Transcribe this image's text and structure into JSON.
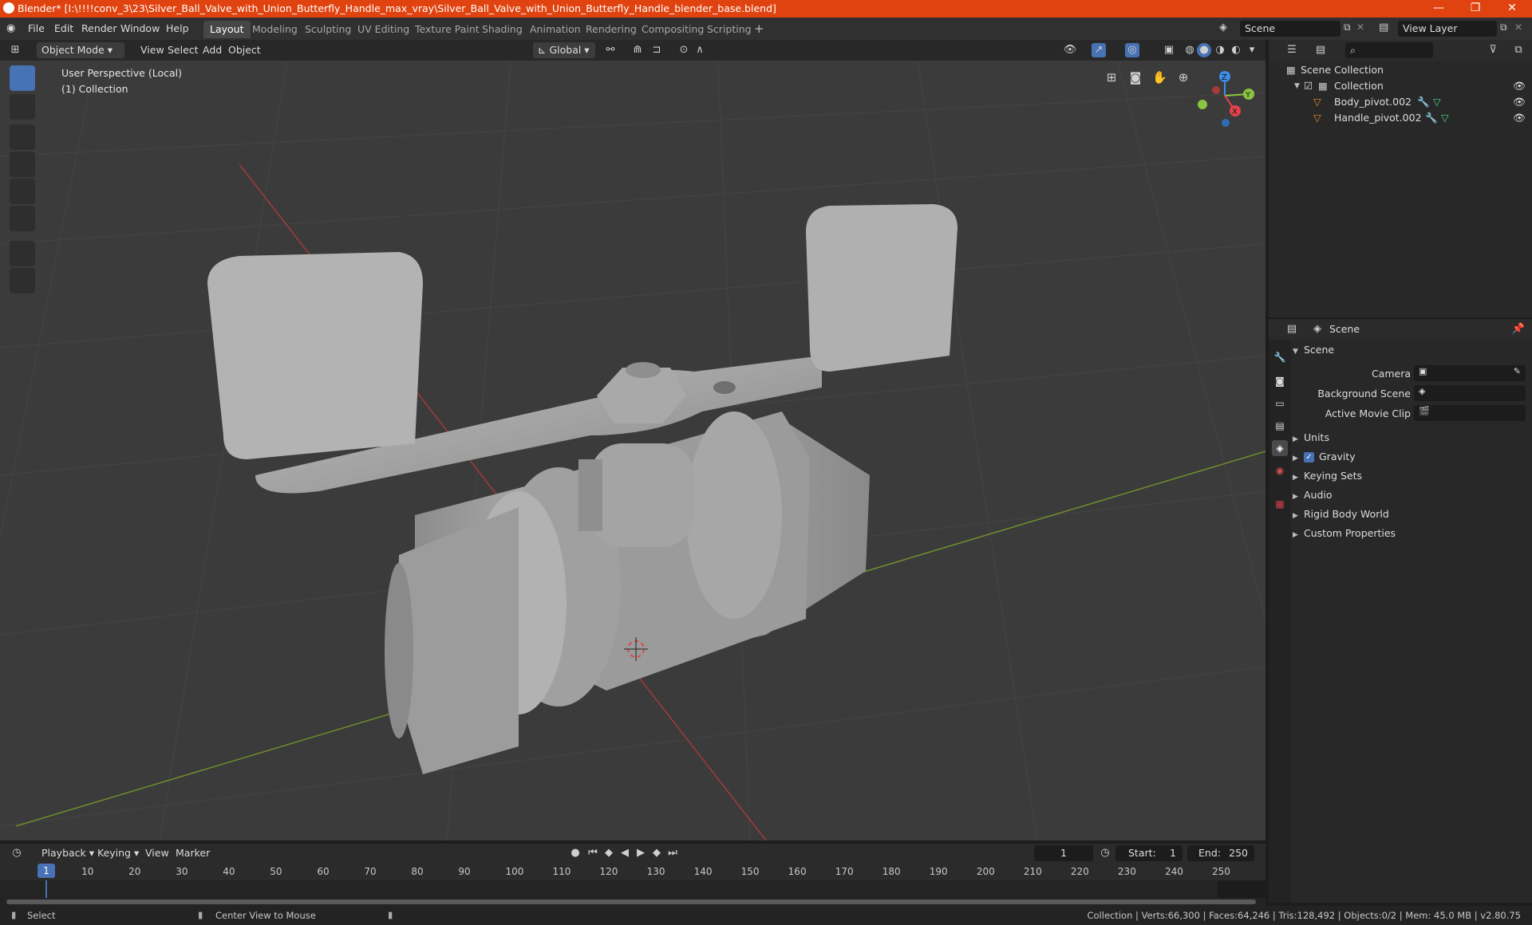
{
  "window": {
    "title": "Blender* [I:\\!!!!conv_3\\23\\Silver_Ball_Valve_with_Union_Butterfly_Handle_max_vray\\Silver_Ball_Valve_with_Union_Butterfly_Handle_blender_base.blend]"
  },
  "menu": [
    "File",
    "Edit",
    "Render",
    "Window",
    "Help"
  ],
  "workspaces": [
    "Layout",
    "Modeling",
    "Sculpting",
    "UV Editing",
    "Texture Paint",
    "Shading",
    "Animation",
    "Rendering",
    "Compositing",
    "Scripting"
  ],
  "active_workspace": "Layout",
  "scene_field": "Scene",
  "view_layer_field": "View Layer",
  "viewport_header": {
    "mode": "Object Mode",
    "menus": [
      "View",
      "Select",
      "Add",
      "Object"
    ],
    "transform": "Global"
  },
  "viewport": {
    "info_line1": "User Perspective (Local)",
    "info_line2": "(1) Collection"
  },
  "gizmo": {
    "z": "Z",
    "y": "Y",
    "x": "X"
  },
  "outliner": {
    "root": "Scene Collection",
    "collection": "Collection",
    "objects": [
      "Body_pivot.002",
      "Handle_pivot.002"
    ]
  },
  "properties": {
    "header": "Scene",
    "section": "Scene",
    "camera_label": "Camera",
    "bg_scene_label": "Background Scene",
    "movie_clip_label": "Active Movie Clip",
    "panels": [
      "Units",
      "Gravity",
      "Keying Sets",
      "Audio",
      "Rigid Body World",
      "Custom Properties"
    ]
  },
  "timeline": {
    "menus": [
      "Playback",
      "Keying",
      "View",
      "Marker"
    ],
    "current_frame": "1",
    "start_label": "Start:",
    "start": "1",
    "end_label": "End:",
    "end": "250",
    "ticks": [
      "1",
      "10",
      "20",
      "30",
      "40",
      "50",
      "60",
      "70",
      "80",
      "90",
      "100",
      "110",
      "120",
      "130",
      "140",
      "150",
      "160",
      "170",
      "180",
      "190",
      "200",
      "210",
      "220",
      "230",
      "240",
      "250"
    ]
  },
  "statusbar": {
    "select": "Select",
    "center": "Center View to Mouse",
    "stats": "Collection | Verts:66,300 | Faces:64,246 | Tris:128,492 | Objects:0/2 | Mem: 45.0 MB | v2.80.75"
  },
  "colors": {
    "titlebar": "#e0430f",
    "accent": "#4772b3",
    "axis_x": "#e5434b",
    "axis_y": "#8bc53f",
    "axis_z": "#3d8ee6"
  }
}
